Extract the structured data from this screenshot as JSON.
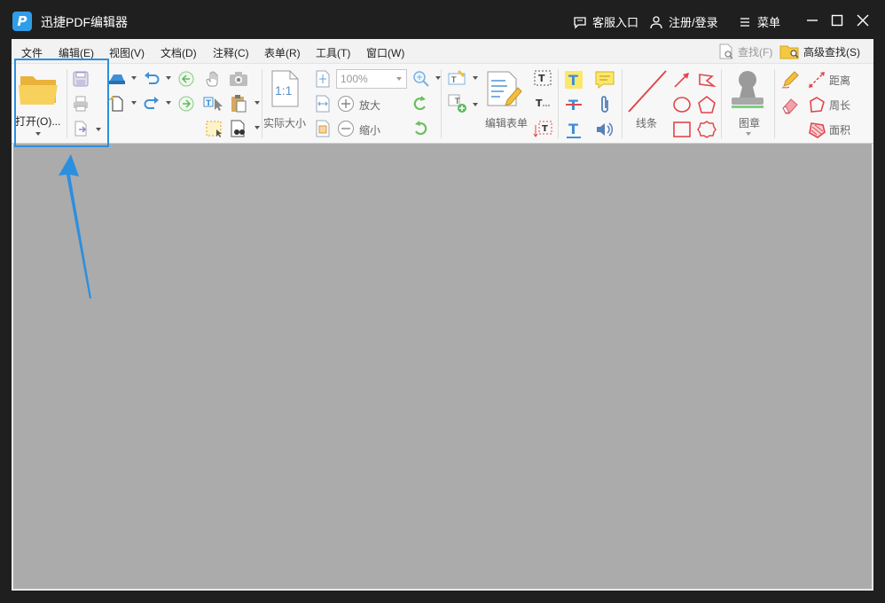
{
  "titlebar": {
    "logo_letter": "P",
    "title": "迅捷PDF编辑器",
    "service": "客服入口",
    "login": "注册/登录",
    "menu": "菜单",
    "service_icon": "chat-bubble-icon",
    "login_icon": "user-icon",
    "menu_icon": "hamburger-icon"
  },
  "menubar": {
    "items": [
      "文件",
      "编辑(E)",
      "视图(V)",
      "文档(D)",
      "注释(C)",
      "表单(R)",
      "工具(T)",
      "窗口(W)"
    ],
    "find": "查找(F)",
    "advanced_find": "高级查找(S)"
  },
  "ribbon": {
    "open_label": "打开(O)...",
    "actual_size_label": "实际大小",
    "actual_size_icon_text": "1:1",
    "zoom_value": "100%",
    "zoom_in_label": "放大",
    "zoom_out_label": "缩小",
    "edit_form_label": "编辑表单",
    "line_label": "线条",
    "stamp_label": "图章",
    "distance_label": "距离",
    "perimeter_label": "周长",
    "area_label": "面积"
  },
  "colors": {
    "accent": "#2b8fe0",
    "titlebar_bg": "#1f1f1f",
    "doc_bg": "#ababab",
    "ribbon_bg": "#f7f7f7",
    "shape_red": "#e0474c",
    "green": "#5fb85f",
    "folder_yellow": "#f5c842"
  }
}
